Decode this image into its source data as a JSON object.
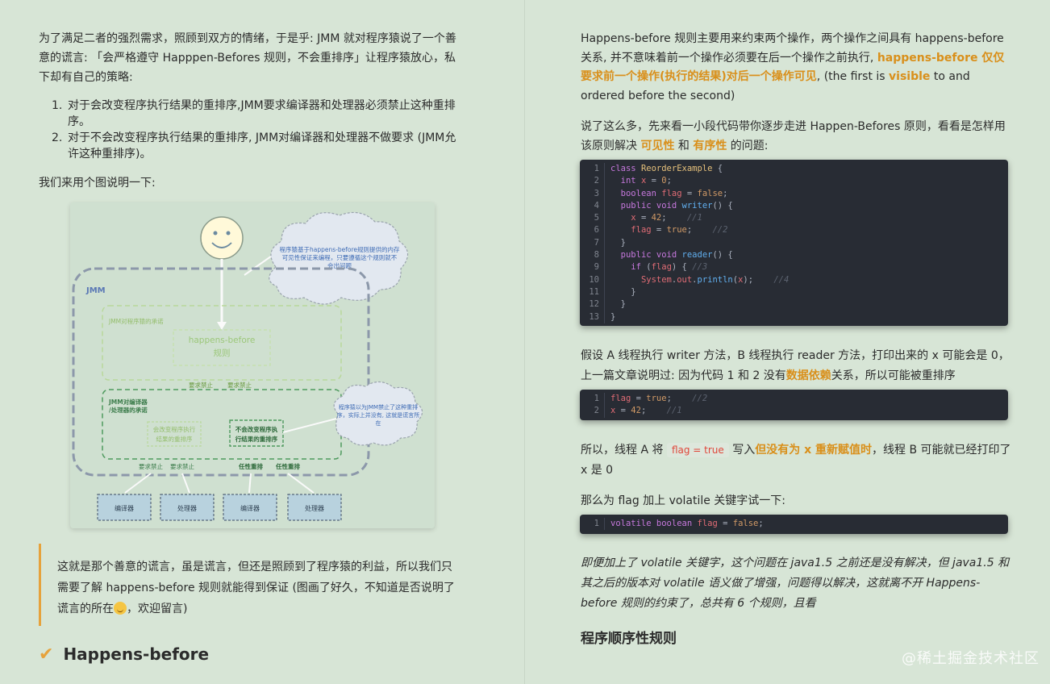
{
  "left": {
    "intro": "为了满足二者的强烈需求，照顾到双方的情绪，于是乎: JMM 就对程序猿说了一个善意的谎言: 「会严格遵守 Happpen-Befores 规则，不会重排序」让程序猿放心，私下却有自己的策略:",
    "list": [
      {
        "num": "1.",
        "text": "对于会改变程序执行结果的重排序,JMM要求编译器和处理器必须禁止这种重排序。"
      },
      {
        "num": "2.",
        "text": "对于不会改变程序执行结果的重排序, JMM对编译器和处理器不做要求 (JMM允许这种重排序)。"
      }
    ],
    "demo_line": "我们来用个图说明一下:",
    "quote": {
      "part1": "这就是那个善意的谎言，虽是谎言，但还是照顾到了程序猿的利益，所以我们只需要了解 happens-before 规则就能得到保证 (图画了好久，不知道是否说明了谎言的所在",
      "part2": "，欢迎留言)"
    },
    "heading": "Happens-before"
  },
  "diagram": {
    "cloud1": [
      "程序猿基于happens-before规则提供的内存",
      "可见性保证来编程，只要遵循这个规则就不",
      "会出问题"
    ],
    "jmm": "JMM",
    "promise_to_programmer": "JMM对程序猿的承诺",
    "hb_rule": [
      "happens-before",
      "规则"
    ],
    "req_forbid_1": "要求禁止",
    "req_forbid_2": "要求禁止",
    "promise_to_compiler": [
      "JMM对编译器",
      "/处理器的承诺"
    ],
    "changes_result": [
      "会改变程序执行",
      "结果的重排序"
    ],
    "no_change_result": [
      "不会改变程序执",
      "行结果的重排序"
    ],
    "cloud2": [
      "程序猿以为JMM禁止了这种重排",
      "序，实际上并没有, 这就是谎言所",
      "在"
    ],
    "bottom_labels": [
      "要求禁止",
      "要求禁止",
      "任性重排",
      "任性重排"
    ],
    "boxes": [
      "编译器",
      "处理器",
      "编译器",
      "处理器"
    ]
  },
  "right": {
    "p1": {
      "a": "Happens-before 规则主要用来约束两个操作，两个操作之间具有 happens-before 关系, 并不意味着前一个操作必须要在后一个操作之前执行, ",
      "b": "happens-before 仅仅要求前一个操作(执行的结果)对后一个操作可见",
      "c": ", (the first is ",
      "d": "visible",
      "e": " to and ordered before the second)"
    },
    "p2": {
      "a": "说了这么多，先来看一小段代码带你逐步走进 Happen-Befores 原则，看看是怎样用该原则解决 ",
      "b": "可见性",
      "c": " 和 ",
      "d": "有序性",
      "e": " 的问题:"
    },
    "p3": {
      "a": "假设 A 线程执行 writer 方法，B 线程执行 reader 方法，打印出来的 x 可能会是 0，上一篇文章说明过: 因为代码 1 和 2 没有",
      "b": "数据依赖",
      "c": "关系，所以可能被重排序"
    },
    "p4": {
      "a": "所以，线程 A 将 ",
      "code": "flag = true",
      "b": " 写入",
      "c": "但没有为 x 重新赋值时",
      "d": "，线程 B 可能就已经打印了 x 是 0"
    },
    "p5": "那么为 flag 加上 volatile 关键字试一下:",
    "p6": "即便加上了 volatile 关键字，这个问题在 java1.5 之前还是没有解决，但 java1.5 和其之后的版本对 volatile 语义做了增强，问题得以解决，这就离不开 Happens-before 规则的约束了，总共有 6 个规则，且看",
    "h2": "程序顺序性规则",
    "watermark": "@稀土掘金技术社区"
  },
  "code1_lines": [
    "1",
    "2",
    "3",
    "4",
    "5",
    "6",
    "7",
    "8",
    "9",
    "10",
    "11",
    "12",
    "13"
  ],
  "code2_lines": [
    "1",
    "2"
  ],
  "code3_lines": [
    "1"
  ]
}
